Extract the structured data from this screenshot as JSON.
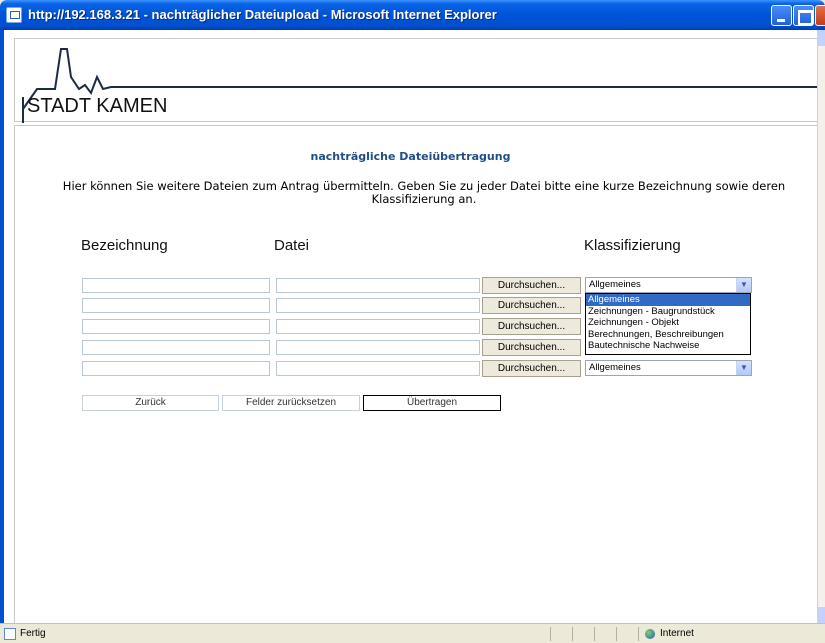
{
  "window": {
    "title": "http://192.168.3.21 - nachträglicher Dateiupload - Microsoft Internet Explorer"
  },
  "header": {
    "logo_text": "STADT KAMEN"
  },
  "page": {
    "heading": "nachträgliche Dateiübertragung",
    "intro": "Hier können Sie weitere Dateien zum Antrag übermitteln. Geben Sie zu jeder Datei bitte eine kurze Bezeichnung sowie deren Klassifizierung an."
  },
  "columns": {
    "bezeichnung": "Bezeichnung",
    "datei": "Datei",
    "klassifizierung": "Klassifizierung"
  },
  "rows": [
    {
      "bezeichnung": "",
      "datei": "",
      "browse_label": "Durchsuchen...",
      "klassifizierung": "Allgemeines"
    },
    {
      "bezeichnung": "",
      "datei": "",
      "browse_label": "Durchsuchen..."
    },
    {
      "bezeichnung": "",
      "datei": "",
      "browse_label": "Durchsuchen..."
    },
    {
      "bezeichnung": "",
      "datei": "",
      "browse_label": "Durchsuchen..."
    },
    {
      "bezeichnung": "",
      "datei": "",
      "browse_label": "Durchsuchen...",
      "klassifizierung": "Allgemeines"
    }
  ],
  "dropdown": {
    "options": [
      "Allgemeines",
      "Zeichnungen - Baugrundstück",
      "Zeichnungen - Objekt",
      "Berechnungen, Beschreibungen",
      "Bautechnische Nachweise"
    ],
    "selected_index": 0
  },
  "buttons": {
    "back": "Zurück",
    "reset": "Felder zurücksetzen",
    "submit": "Übertragen"
  },
  "statusbar": {
    "status": "Fertig",
    "zone": "Internet"
  },
  "colors": {
    "titlebar": "#0053d6",
    "heading": "#1f4e86",
    "selection": "#316ac5"
  }
}
